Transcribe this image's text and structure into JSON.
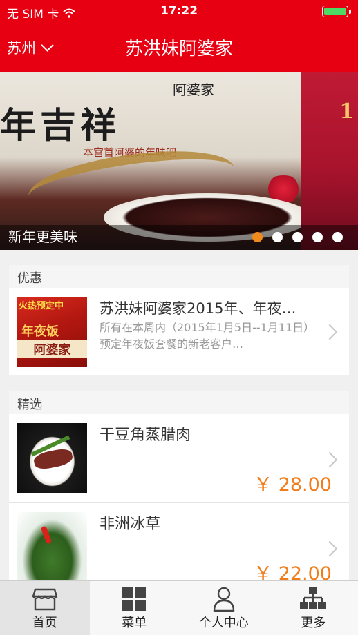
{
  "status_bar": {
    "carrier": "无 SIM 卡",
    "time": "17:22",
    "battery_level": 1.0
  },
  "nav": {
    "city": "苏州",
    "title": "苏洪妹阿婆家"
  },
  "banner": {
    "caption": "新年更美味",
    "dots_count": 5,
    "active_dot": 0,
    "image_text_top": "阿婆家",
    "image_text_main": "年吉祥",
    "image_text_sub": "本宫首阿婆的年味吧",
    "side_text": "1"
  },
  "promo": {
    "section_title": "优惠",
    "item": {
      "title": "苏洪妹阿婆家2015年、年夜…",
      "desc": "所有在本周内（2015年1月5日--1月11日）预定年夜饭套餐的新老客户…",
      "thumb_text_top": "火热预定中",
      "thumb_text_mid": "年夜饭",
      "thumb_text_bot": "阿婆家"
    }
  },
  "picks": {
    "section_title": "精选",
    "items": [
      {
        "name": "干豆角蒸腊肉",
        "price": "￥ 28.00"
      },
      {
        "name": "非洲冰草",
        "price": "￥ 22.00"
      }
    ]
  },
  "tabs": [
    {
      "label": "首页",
      "icon": "home-shop-icon"
    },
    {
      "label": "菜单",
      "icon": "grid-menu-icon"
    },
    {
      "label": "个人中心",
      "icon": "person-icon"
    },
    {
      "label": "更多",
      "icon": "sitemap-icon"
    }
  ],
  "colors": {
    "brand_red": "#e60012",
    "price_orange": "#f07d1a",
    "active_dot": "#f08a1c"
  }
}
